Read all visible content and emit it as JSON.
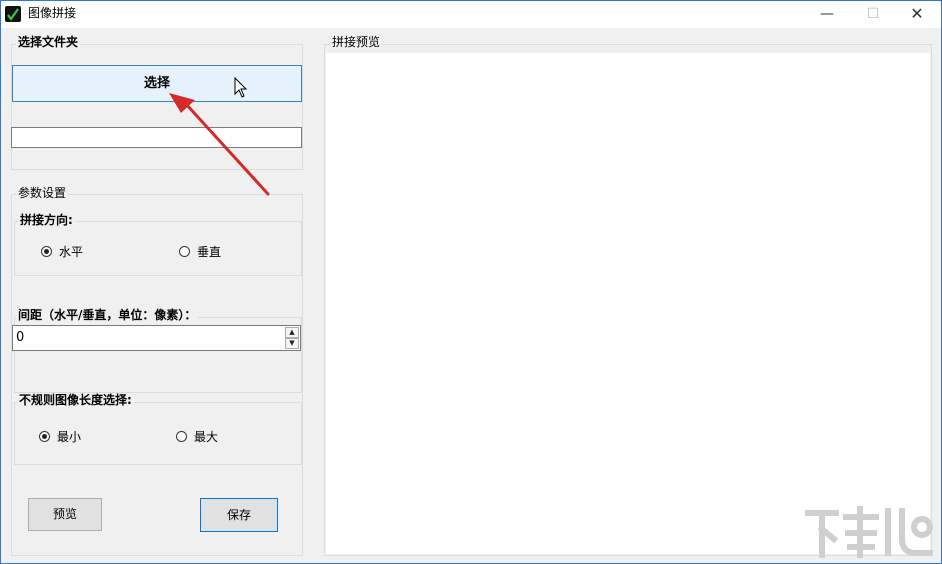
{
  "window": {
    "title": "图像拼接",
    "controls": {
      "minimize": "—",
      "maximize": "☐",
      "close": "✕"
    }
  },
  "folder_section": {
    "label": "选择文件夹",
    "select_button": "选择",
    "path_value": ""
  },
  "params_section": {
    "label": "参数设置",
    "direction": {
      "label": "拼接方向:",
      "options": [
        {
          "label": "水平",
          "checked": true
        },
        {
          "label": "垂直",
          "checked": false
        }
      ]
    },
    "gap": {
      "label": "间距（水平/垂直，单位：像素）：",
      "value": "0"
    },
    "irregular_length": {
      "label": "不规则图像长度选择:",
      "options": [
        {
          "label": "最小",
          "checked": true
        },
        {
          "label": "最大",
          "checked": false
        }
      ]
    },
    "preview_button": "预览",
    "save_button": "保存"
  },
  "preview_section": {
    "label": "拼接预览"
  },
  "annotation": {
    "arrow_color": "#d42a2a"
  },
  "colors": {
    "accent": "#0078d7",
    "select_button_bg": "#e5f1fb"
  }
}
